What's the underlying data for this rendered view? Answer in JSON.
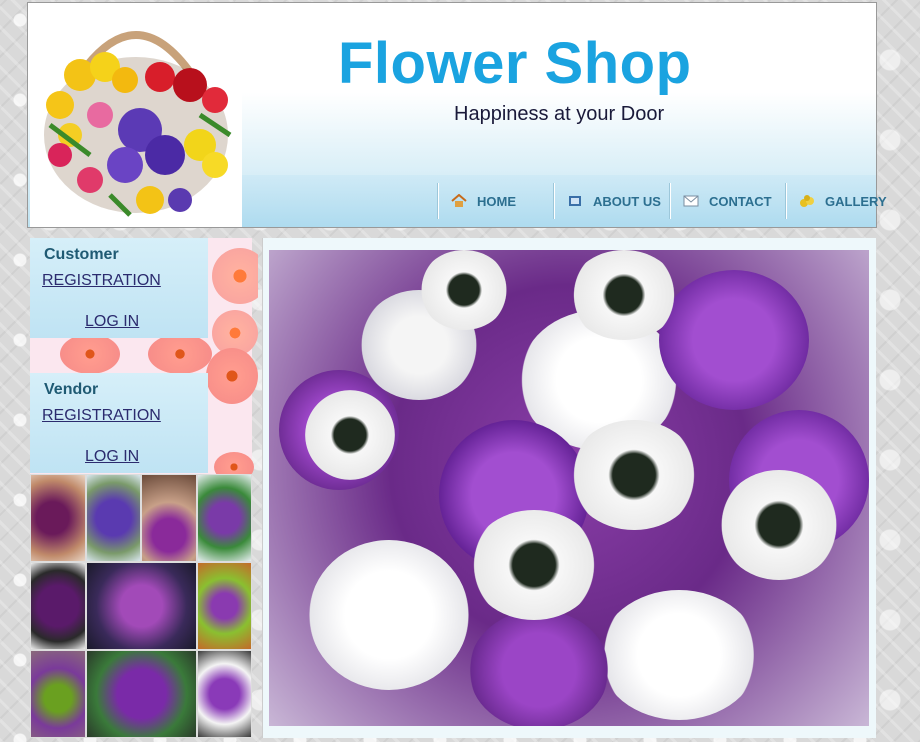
{
  "header": {
    "title": "Flower Shop",
    "tagline": "Happiness at your Door",
    "logo_icon": "flower-basket-image"
  },
  "nav": {
    "items": [
      {
        "label": "HOME",
        "icon": "home-icon"
      },
      {
        "label": "ABOUT US",
        "icon": "book-icon"
      },
      {
        "label": "CONTACT",
        "icon": "envelope-icon"
      },
      {
        "label": "GALLERY",
        "icon": "coins-icon"
      }
    ]
  },
  "sidebar": {
    "customer": {
      "heading": "Customer",
      "register": "REGISTRATION",
      "login": "LOG IN"
    },
    "vendor": {
      "heading": "Vendor",
      "register": "REGISTRATION",
      "login": "LOG IN"
    }
  },
  "colors": {
    "title": "#1aa3e0",
    "nav_text": "#2c6f90",
    "link": "#2b2b6e",
    "menu_bg": "#bfe3f3"
  }
}
